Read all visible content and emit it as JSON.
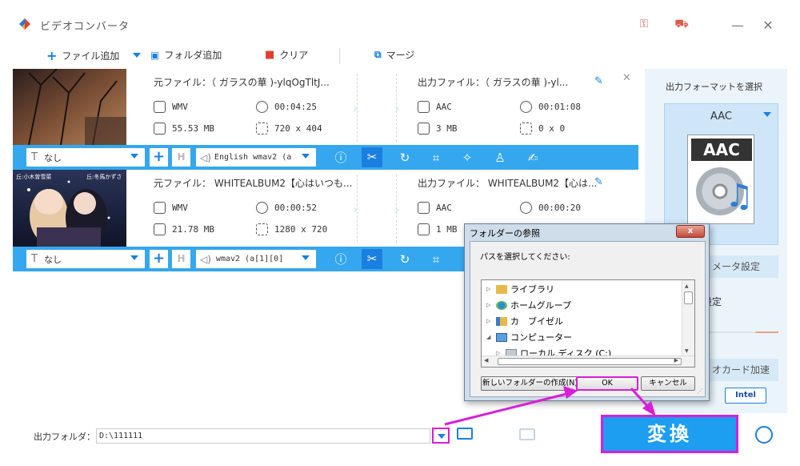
{
  "window": {
    "title": "ビデオコンバータ",
    "key_icon": "key-icon",
    "cart_icon": "cart-icon",
    "minimize": "—",
    "close": "✕"
  },
  "toolbar": {
    "add_file": "ファイル追加",
    "add_folder": "フォルダ追加",
    "clear": "クリア",
    "merge": "マージ"
  },
  "items": [
    {
      "src_title": "元ファイル：（ ガラスの華 )-ylqOgTltJ...",
      "src_format": "WMV",
      "src_duration": "00:04:25",
      "src_size": "55.53 MB",
      "src_resolution": "720 x 404",
      "dst_title": "出力ファイル：（ ガラスの華 )-yl...",
      "dst_format": "AAC",
      "dst_duration": "00:01:08",
      "dst_size": "3 MB",
      "dst_resolution": "0 x 0",
      "subtitle": "なし",
      "audio": "English wmav2 (a",
      "thumb_colors": [
        "#3b2a25",
        "#8a5a3a",
        "#c79a6a"
      ]
    },
    {
      "src_title": "元ファイル： WHITEALBUM2【心はいつも...",
      "src_format": "WMV",
      "src_duration": "00:00:52",
      "src_size": "21.78 MB",
      "src_resolution": "1280 x 720",
      "dst_title": "出力ファイル： WHITEALBUM2【心は...",
      "dst_format": "AAC",
      "dst_duration": "00:00:20",
      "dst_size": "1 MB",
      "subtitle": "なし",
      "audio": "wmav2 (a[1][0]",
      "thumb_caption_left": "丘:小木曽雪菜",
      "thumb_caption_right": "丘:冬馬かずさ",
      "thumb_colors": [
        "#1c2340",
        "#6a5a8a",
        "#e8c8c8"
      ]
    }
  ],
  "right_panel": {
    "title": "出力フォーマットを選択",
    "format": "AAC",
    "param_btn": "メータ設定",
    "setting": "ク設定",
    "hw_accel": "オカード加速",
    "intel": "Intel"
  },
  "bottom": {
    "output_label": "出力フォルダ：",
    "output_path": "D:\\111111",
    "convert": "変換"
  },
  "dialog": {
    "title": "フォルダーの参照",
    "close": "x",
    "prompt": "パスを選択してください:",
    "tree": [
      {
        "label": "ライブラリ",
        "icon": "library-icon"
      },
      {
        "label": "ホームグループ",
        "icon": "homegroup-icon"
      },
      {
        "label": "カ　ブイゼル",
        "icon": "user-folder-icon"
      },
      {
        "label": "コンピューター",
        "icon": "computer-icon"
      },
      {
        "label": "ローカル ディスク (C:)",
        "icon": "disk-icon"
      }
    ],
    "new_folder": "新しいフォルダーの作成(N)",
    "ok": "OK",
    "cancel": "キャンセル"
  },
  "colors": {
    "accent": "#1d9ef0",
    "bar": "#35a7ee",
    "highlight": "#d81ed8"
  }
}
